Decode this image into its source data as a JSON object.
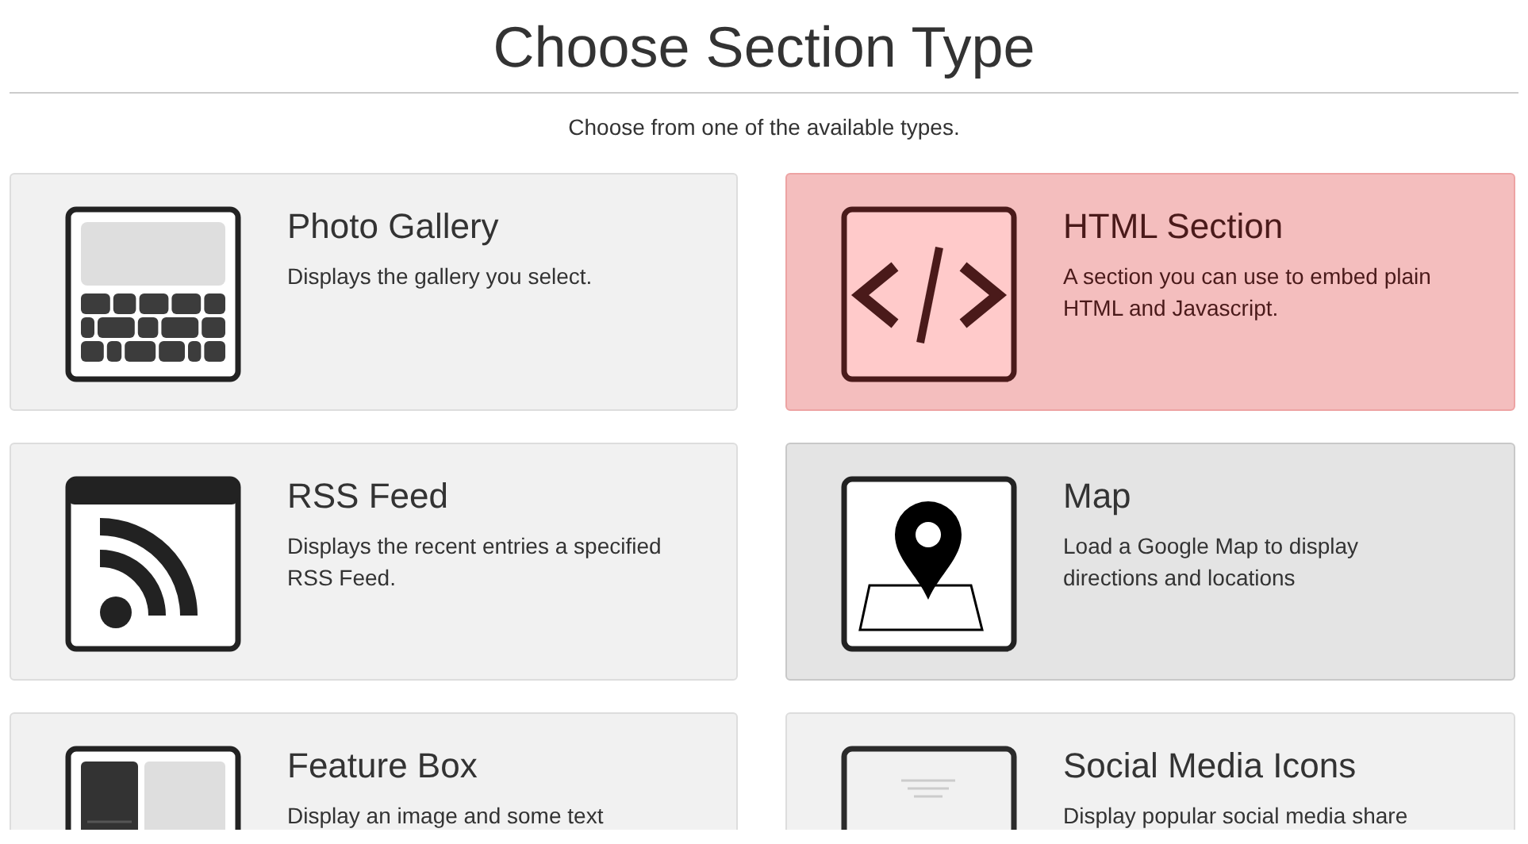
{
  "title": "Choose Section Type",
  "subtitle": "Choose from one of the available types.",
  "sections": [
    {
      "kind": "gallery",
      "name": "Photo Gallery",
      "description": "Displays the gallery you select.",
      "selected": false,
      "hovered": false
    },
    {
      "kind": "code",
      "name": "HTML Section",
      "description": "A section you can use to embed plain HTML and Javascript.",
      "selected": true,
      "hovered": false
    },
    {
      "kind": "rss",
      "name": "RSS Feed",
      "description": "Displays the recent entries a specified RSS Feed.",
      "selected": false,
      "hovered": false
    },
    {
      "kind": "map",
      "name": "Map",
      "description": "Load a Google Map to display directions and locations",
      "selected": false,
      "hovered": true
    },
    {
      "kind": "feature",
      "name": "Feature Box",
      "description": "Display an image and some text",
      "selected": false,
      "hovered": false
    },
    {
      "kind": "social",
      "name": "Social Media Icons",
      "description": "Display popular social media share",
      "selected": false,
      "hovered": false
    }
  ]
}
